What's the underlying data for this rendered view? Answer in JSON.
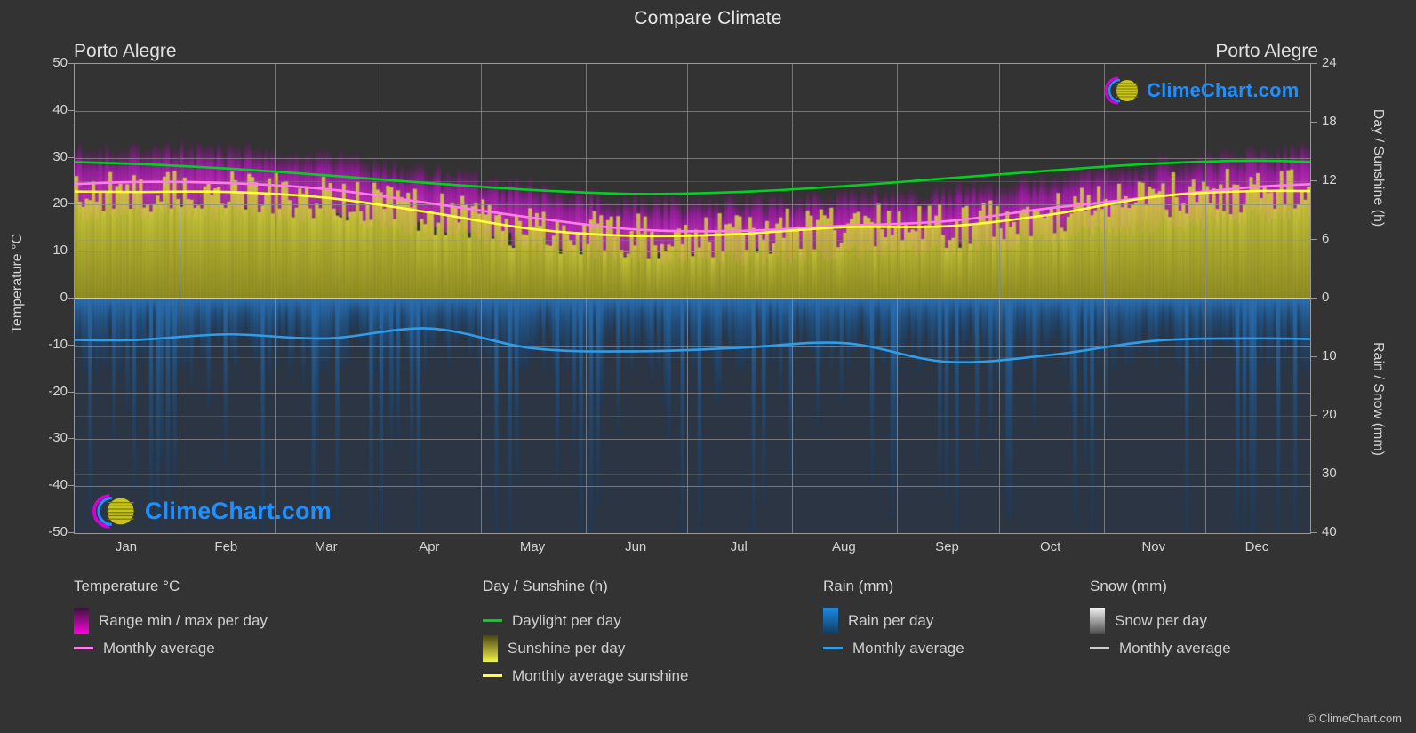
{
  "header": {
    "title": "Compare Climate",
    "location_left": "Porto Alegre",
    "location_right": "Porto Alegre"
  },
  "branding": {
    "watermark_text": "ClimeChart.com",
    "copyright": "© ClimeChart.com"
  },
  "legend": {
    "temperature": {
      "heading": "Temperature °C",
      "items": [
        {
          "label": "Range min / max per day",
          "marker": "gradient-box",
          "color": "#ff00e0"
        },
        {
          "label": "Monthly average",
          "marker": "line",
          "color": "#ff7de8"
        }
      ]
    },
    "daysunshine": {
      "heading": "Day / Sunshine (h)",
      "items": [
        {
          "label": "Daylight per day",
          "marker": "line",
          "color": "#00d21e"
        },
        {
          "label": "Sunshine per day",
          "marker": "gradient-box",
          "color": "#f2f248"
        },
        {
          "label": "Monthly average sunshine",
          "marker": "line",
          "color": "#ffff3a"
        }
      ]
    },
    "rain": {
      "heading": "Rain (mm)",
      "items": [
        {
          "label": "Rain per day",
          "marker": "gradient-box",
          "color": "#1a8ae5"
        },
        {
          "label": "Monthly average",
          "marker": "line",
          "color": "#2f9de8"
        }
      ]
    },
    "snow": {
      "heading": "Snow (mm)",
      "items": [
        {
          "label": "Snow per day",
          "marker": "gradient-box",
          "color": "#e8e8e8"
        },
        {
          "label": "Monthly average",
          "marker": "line",
          "color": "#cccccc"
        }
      ]
    }
  },
  "chart_data": {
    "type": "area",
    "title": "Compare Climate",
    "subtitle": "Porto Alegre",
    "xlabel": "",
    "x_tick_labels": [
      "Jan",
      "Feb",
      "Mar",
      "Apr",
      "May",
      "Jun",
      "Jul",
      "Aug",
      "Sep",
      "Oct",
      "Nov",
      "Dec"
    ],
    "grid": true,
    "legend_position": "below",
    "axes": [
      {
        "id": "temperature",
        "side": "left",
        "label": "Temperature °C",
        "ticks": [
          50,
          40,
          30,
          20,
          10,
          0,
          -10,
          -20,
          -30,
          -40,
          -50
        ],
        "range": [
          -50,
          50
        ]
      },
      {
        "id": "day_sunshine",
        "side": "right",
        "label": "Day / Sunshine (h)",
        "ticks": [
          24,
          18,
          12,
          6,
          0
        ],
        "range": [
          0,
          24
        ],
        "covers": "upper half"
      },
      {
        "id": "rain_snow",
        "side": "right",
        "label": "Rain / Snow (mm)",
        "ticks": [
          0,
          10,
          20,
          30,
          40
        ],
        "range": [
          0,
          40
        ],
        "inverted": true,
        "covers": "lower half"
      }
    ],
    "series": [
      {
        "name": "Monthly average",
        "group": "Temperature °C",
        "unit": "°C",
        "color": "#ff7de8",
        "axis": "temperature",
        "categories": [
          "Jan",
          "Feb",
          "Mar",
          "Apr",
          "May",
          "Jun",
          "Jul",
          "Aug",
          "Sep",
          "Oct",
          "Nov",
          "Dec"
        ],
        "values": [
          24.8,
          24.6,
          23.3,
          20.3,
          17.2,
          14.7,
          14.4,
          15.5,
          16.5,
          19.3,
          21.7,
          23.8
        ]
      },
      {
        "name": "Range max per day",
        "group": "Temperature °C",
        "unit": "°C",
        "color": "#d400d4",
        "axis": "temperature",
        "categories": [
          "Jan",
          "Feb",
          "Mar",
          "Apr",
          "May",
          "Jun",
          "Jul",
          "Aug",
          "Sep",
          "Oct",
          "Nov",
          "Dec"
        ],
        "values": [
          30.5,
          30.0,
          28.6,
          25.4,
          22.0,
          19.2,
          19.1,
          20.3,
          21.3,
          24.2,
          26.9,
          29.2
        ]
      },
      {
        "name": "Range min per day",
        "group": "Temperature °C",
        "unit": "°C",
        "color": "#d400d4",
        "axis": "temperature",
        "categories": [
          "Jan",
          "Feb",
          "Mar",
          "Apr",
          "May",
          "Jun",
          "Jul",
          "Aug",
          "Sep",
          "Oct",
          "Nov",
          "Dec"
        ],
        "values": [
          20.3,
          20.1,
          18.9,
          16.0,
          13.1,
          10.8,
          10.4,
          11.4,
          12.4,
          15.0,
          17.1,
          19.1
        ]
      },
      {
        "name": "Daylight per day",
        "group": "Day / Sunshine (h)",
        "unit": "h",
        "color": "#00d21e",
        "axis": "day_sunshine",
        "categories": [
          "Jan",
          "Feb",
          "Mar",
          "Apr",
          "May",
          "Jun",
          "Jul",
          "Aug",
          "Sep",
          "Oct",
          "Nov",
          "Dec"
        ],
        "values": [
          13.8,
          13.3,
          12.6,
          11.8,
          11.1,
          10.7,
          10.9,
          11.5,
          12.3,
          13.1,
          13.8,
          14.1
        ]
      },
      {
        "name": "Monthly average sunshine",
        "group": "Day / Sunshine (h)",
        "unit": "h",
        "color": "#ffff3a",
        "axis": "day_sunshine",
        "categories": [
          "Jan",
          "Feb",
          "Mar",
          "Apr",
          "May",
          "Jun",
          "Jul",
          "Aug",
          "Sep",
          "Oct",
          "Nov",
          "Dec"
        ],
        "values": [
          10.9,
          10.9,
          10.3,
          8.8,
          7.1,
          6.4,
          6.6,
          7.3,
          7.4,
          8.6,
          10.4,
          11.0
        ]
      },
      {
        "name": "Rain monthly average",
        "group": "Rain (mm)",
        "unit": "mm",
        "color": "#2f9de8",
        "axis": "rain_snow",
        "categories": [
          "Jan",
          "Feb",
          "Mar",
          "Apr",
          "May",
          "Jun",
          "Jul",
          "Aug",
          "Sep",
          "Oct",
          "Nov",
          "Dec"
        ],
        "values": [
          7.1,
          6.1,
          6.8,
          5.1,
          8.5,
          9.0,
          8.4,
          7.6,
          10.8,
          9.6,
          7.2,
          6.8
        ]
      },
      {
        "name": "Snow monthly average",
        "group": "Snow (mm)",
        "unit": "mm",
        "color": "#cccccc",
        "axis": "rain_snow",
        "categories": [
          "Jan",
          "Feb",
          "Mar",
          "Apr",
          "May",
          "Jun",
          "Jul",
          "Aug",
          "Sep",
          "Oct",
          "Nov",
          "Dec"
        ],
        "values": [
          0,
          0,
          0,
          0,
          0,
          0,
          0,
          0,
          0,
          0,
          0,
          0
        ]
      }
    ]
  }
}
